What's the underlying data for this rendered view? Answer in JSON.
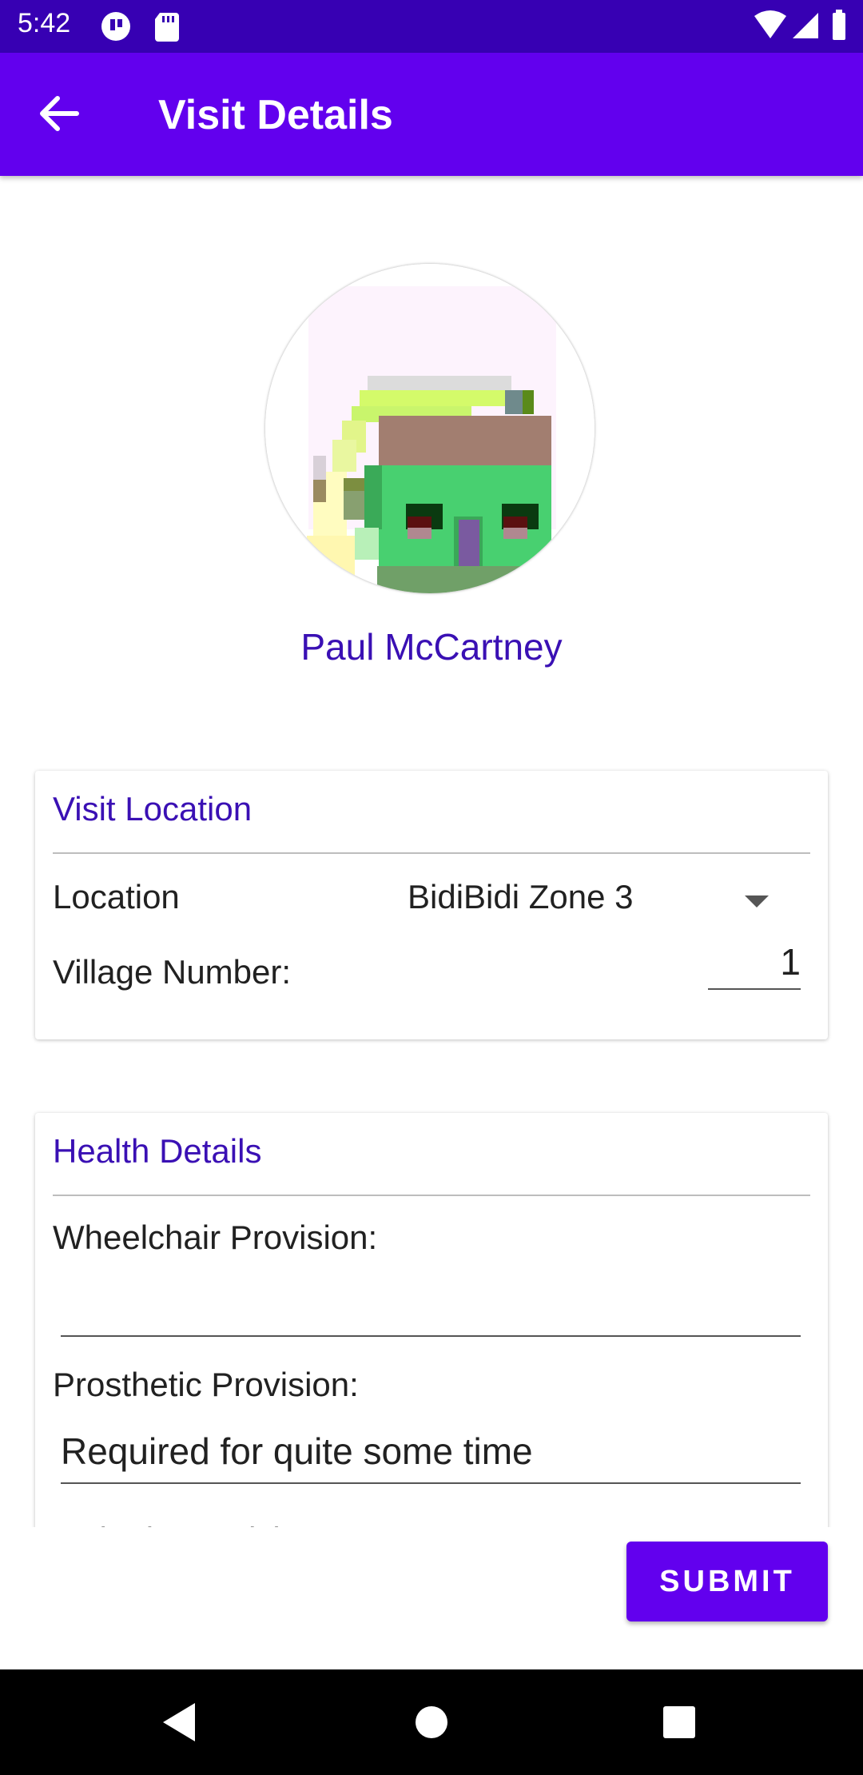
{
  "status_bar": {
    "time": "5:42",
    "left_icons": [
      "pocket-icon",
      "sd-card-icon"
    ],
    "right_icons": [
      "wifi-icon",
      "cell-signal-icon",
      "battery-icon"
    ]
  },
  "app_bar": {
    "title": "Visit Details",
    "back_icon": "arrow-back-icon",
    "color": "#6200ee"
  },
  "client": {
    "name": "Paul McCartney",
    "avatar": "pixel-house-avatar"
  },
  "visit_location": {
    "header": "Visit Location",
    "location_label": "Location",
    "location_value": "BidiBidi Zone 3",
    "village_label": "Village Number:",
    "village_value": "1"
  },
  "health_details": {
    "header": "Health Details",
    "wheelchair_label": "Wheelchair Provision:",
    "wheelchair_value": "",
    "prosthetic_label": "Prosthetic Provision:",
    "prosthetic_value": "Required for quite some time",
    "orthotic_label": "Orthotic Provision:"
  },
  "submit_label": "SUBMIT",
  "nav_bar": [
    "back-icon",
    "home-icon",
    "recents-icon"
  ],
  "colors": {
    "accent": "#6200ee",
    "status_bar": "#3700b3",
    "header_text": "#3a10b4"
  }
}
